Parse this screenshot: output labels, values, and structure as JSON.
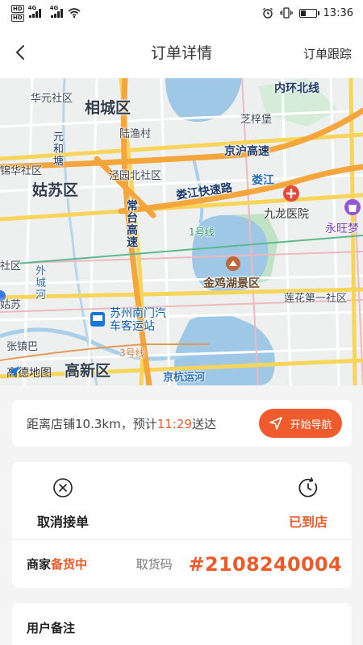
{
  "status_bar": {
    "hd1": "HD",
    "hd2": "HD",
    "net1": "4G",
    "net2": "4G",
    "time": "13:36"
  },
  "header": {
    "title": "订单详情",
    "track_label": "订单跟踪"
  },
  "map": {
    "labels": {
      "xiangcheng": "相城区",
      "gusu": "姑苏区",
      "gusu_short": "姑苏",
      "huayuan": "华元社区",
      "lvyu": "陆渔村",
      "jingyuanbei": "泾园北社区",
      "jinghu_expressway": "京沪高速",
      "loujiang_expressway": "娄江快速路",
      "loujiang": "娄江",
      "changtai_expressway": "常台高速",
      "zhiyubao": "芝梓堡",
      "jiulong_hospital": "九龙医院",
      "yongwang": "永旺梦",
      "line1": "1号线",
      "jinji_lake": "金鸡湖景区",
      "lianhua": "莲花第一社区",
      "waicheng_river": "外城河",
      "nanmen_station": "苏州南门汽车客运站",
      "zhangzhenba": "张镇巴",
      "line3": "3号线",
      "jinghang_canal": "京杭运河",
      "gaoxin": "高新区",
      "yuanhetang": "元和塘",
      "jinshe": "锦华社区",
      "she": "社区",
      "neihuan_north": "内环北线",
      "amap": "高德地图"
    }
  },
  "delivery": {
    "distance_prefix": "距离店铺10.3km，预计",
    "eta_time": "11:29",
    "distance_suffix": "送达",
    "nav_button": "开始导航"
  },
  "actions": {
    "cancel_label": "取消接单",
    "arrived_label": "已到店"
  },
  "order_status": {
    "merchant_prefix": "商家",
    "merchant_status": "备货中",
    "code_label": "取货码",
    "code_value": "#2108240004"
  },
  "note": {
    "title": "用户备注"
  },
  "colors": {
    "accent": "#ef5b2c",
    "map_water": "#9ec8e6",
    "map_green": "#bfe3c4"
  }
}
